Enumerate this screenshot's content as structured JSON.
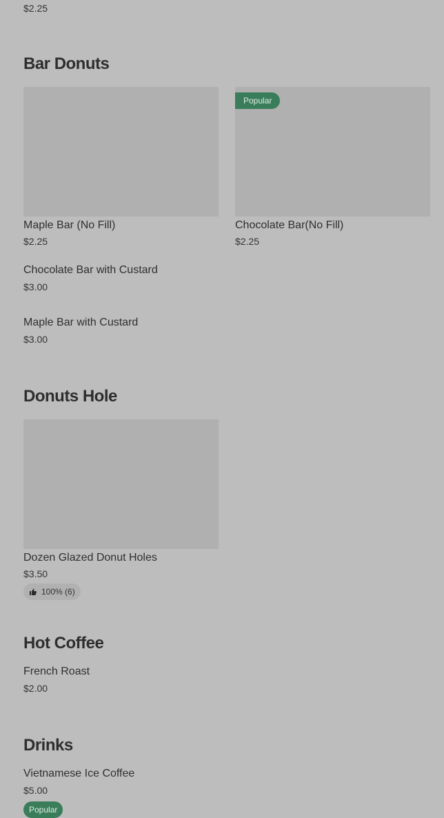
{
  "top_item": {
    "price": "$2.25"
  },
  "sections": {
    "bar_donuts": {
      "title": "Bar Donuts",
      "items": [
        {
          "name": "Maple Bar (No Fill)",
          "price": "$2.25"
        },
        {
          "name": "Chocolate Bar(No Fill)",
          "price": "$2.25",
          "badge": "Popular"
        },
        {
          "name": "Chocolate Bar with Custard",
          "price": "$3.00"
        },
        {
          "name": "Maple Bar with Custard",
          "price": "$3.00"
        }
      ]
    },
    "donuts_hole": {
      "title": "Donuts Hole",
      "items": [
        {
          "name": "Dozen Glazed Donut Holes",
          "price": "$3.50",
          "rating": "100% (6)"
        }
      ]
    },
    "hot_coffee": {
      "title": "Hot Coffee",
      "items": [
        {
          "name": "French Roast",
          "price": "$2.00"
        }
      ]
    },
    "drinks": {
      "title": "Drinks",
      "items": [
        {
          "name": "Vietnamese Ice Coffee",
          "price": "$5.00",
          "badge": "Popular"
        }
      ]
    }
  },
  "icons": {
    "rating": "thumbs-up-icon"
  },
  "colors": {
    "popular_badge": "#3a7d5a",
    "background": "#bdbdbd",
    "image_placeholder": "#b0b0b0"
  }
}
